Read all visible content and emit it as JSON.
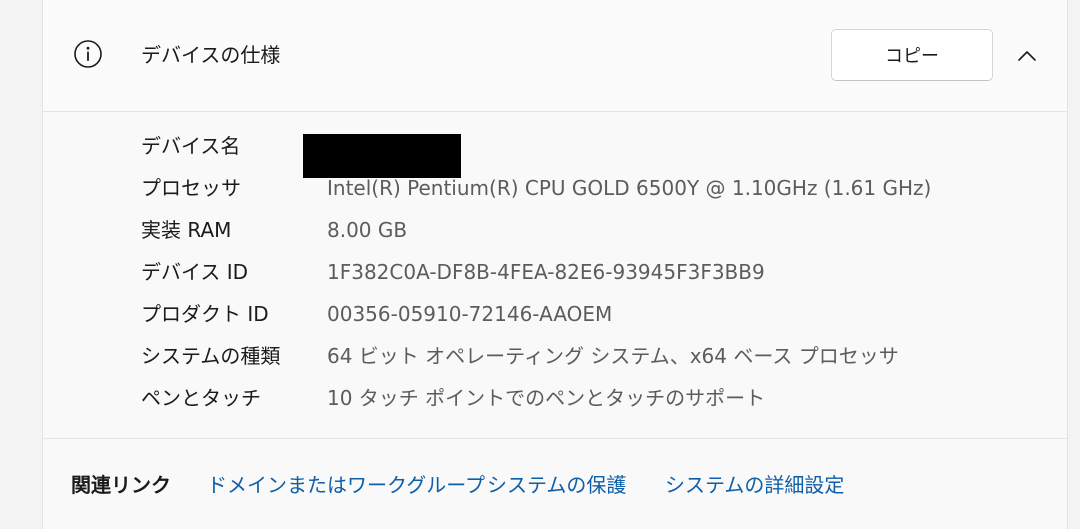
{
  "header": {
    "icon": "info-icon",
    "title": "デバイスの仕様",
    "copy_label": "コピー",
    "toggle_icon": "chevron-up-icon"
  },
  "specs": [
    {
      "label": "デバイス名",
      "value": ""
    },
    {
      "label": "プロセッサ",
      "value": "Intel(R) Pentium(R) CPU GOLD 6500Y @ 1.10GHz (1.61 GHz)"
    },
    {
      "label": "実装 RAM",
      "value": "8.00 GB"
    },
    {
      "label": "デバイス ID",
      "value": "1F382C0A-DF8B-4FEA-82E6-93945F3F3BB9"
    },
    {
      "label": "プロダクト ID",
      "value": "00356-05910-72146-AAOEM"
    },
    {
      "label": "システムの種類",
      "value": "64 ビット オペレーティング システム、x64 ベース プロセッサ"
    },
    {
      "label": "ペンとタッチ",
      "value": "10 タッチ ポイントでのペンとタッチのサポート"
    }
  ],
  "footer": {
    "related_label": "関連リンク",
    "links": [
      "ドメインまたはワークグループ",
      "システムの保護",
      "システムの詳細設定"
    ]
  },
  "colors": {
    "link": "#0f5fa8",
    "value_text": "#5c5c5c",
    "panel_bg": "#f9f9f9"
  }
}
